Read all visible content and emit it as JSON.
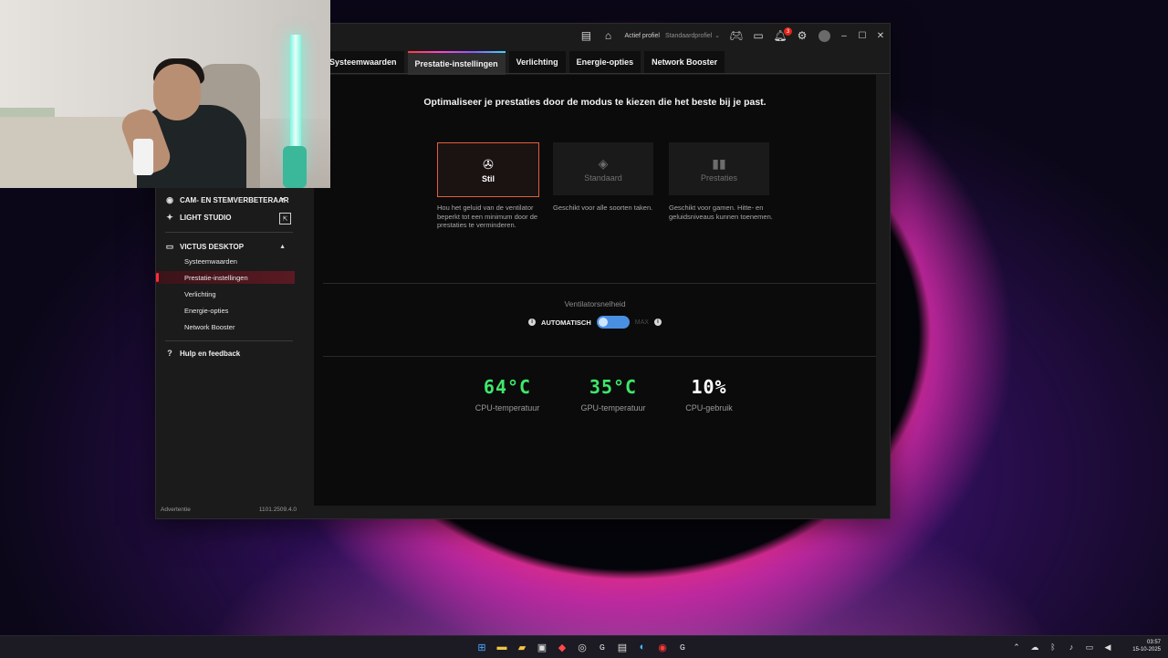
{
  "titlebar": {
    "active_profile_label": "Actief profiel",
    "active_profile_value": "Standaardprofiel",
    "notification_count": "3"
  },
  "tabs": [
    {
      "label": "Systeemwaarden"
    },
    {
      "label": "Prestatie-instellingen"
    },
    {
      "label": "Verlichting"
    },
    {
      "label": "Energie-opties"
    },
    {
      "label": "Network Booster"
    }
  ],
  "sidebar": {
    "cam_label": "CAM- EN STEMVERBETERAAR",
    "light_label": "LIGHT STUDIO",
    "device_label": "VICTUS DESKTOP",
    "sub_items": [
      {
        "label": "Systeemwaarden"
      },
      {
        "label": "Prestatie-instellingen"
      },
      {
        "label": "Verlichting"
      },
      {
        "label": "Energie-opties"
      },
      {
        "label": "Network Booster"
      }
    ],
    "help_label": "Hulp en feedback",
    "ad_label": "Advertentie",
    "version": "1101.2509.4.0"
  },
  "content": {
    "headline": "Optimaliseer je prestaties door de modus te kiezen die het beste bij je past.",
    "modes": [
      {
        "label": "Stil",
        "icon": "fan-icon",
        "description": "Hou het geluid van de ventilator beperkt tot een minimum door de prestaties te verminderen."
      },
      {
        "label": "Standaard",
        "icon": "diamond-icon",
        "description": "Geschikt voor alle soorten taken."
      },
      {
        "label": "Prestaties",
        "icon": "bar-chart-icon",
        "description": "Geschikt voor gamen. Hitte- en geluidsniveaus kunnen toenemen."
      }
    ],
    "fan": {
      "title": "Ventilatorsnelheid",
      "auto_label": "AUTOMATISCH",
      "max_label": "MAX"
    },
    "stats": [
      {
        "value": "64°C",
        "label": "CPU-temperatuur",
        "color": "#3ee86a"
      },
      {
        "value": "35°C",
        "label": "GPU-temperatuur",
        "color": "#3ee86a"
      },
      {
        "value": "10%",
        "label": "CPU-gebruik",
        "color": "#ffffff"
      }
    ]
  },
  "taskbar": {
    "time": "03:57",
    "date": "15-10-2025"
  }
}
